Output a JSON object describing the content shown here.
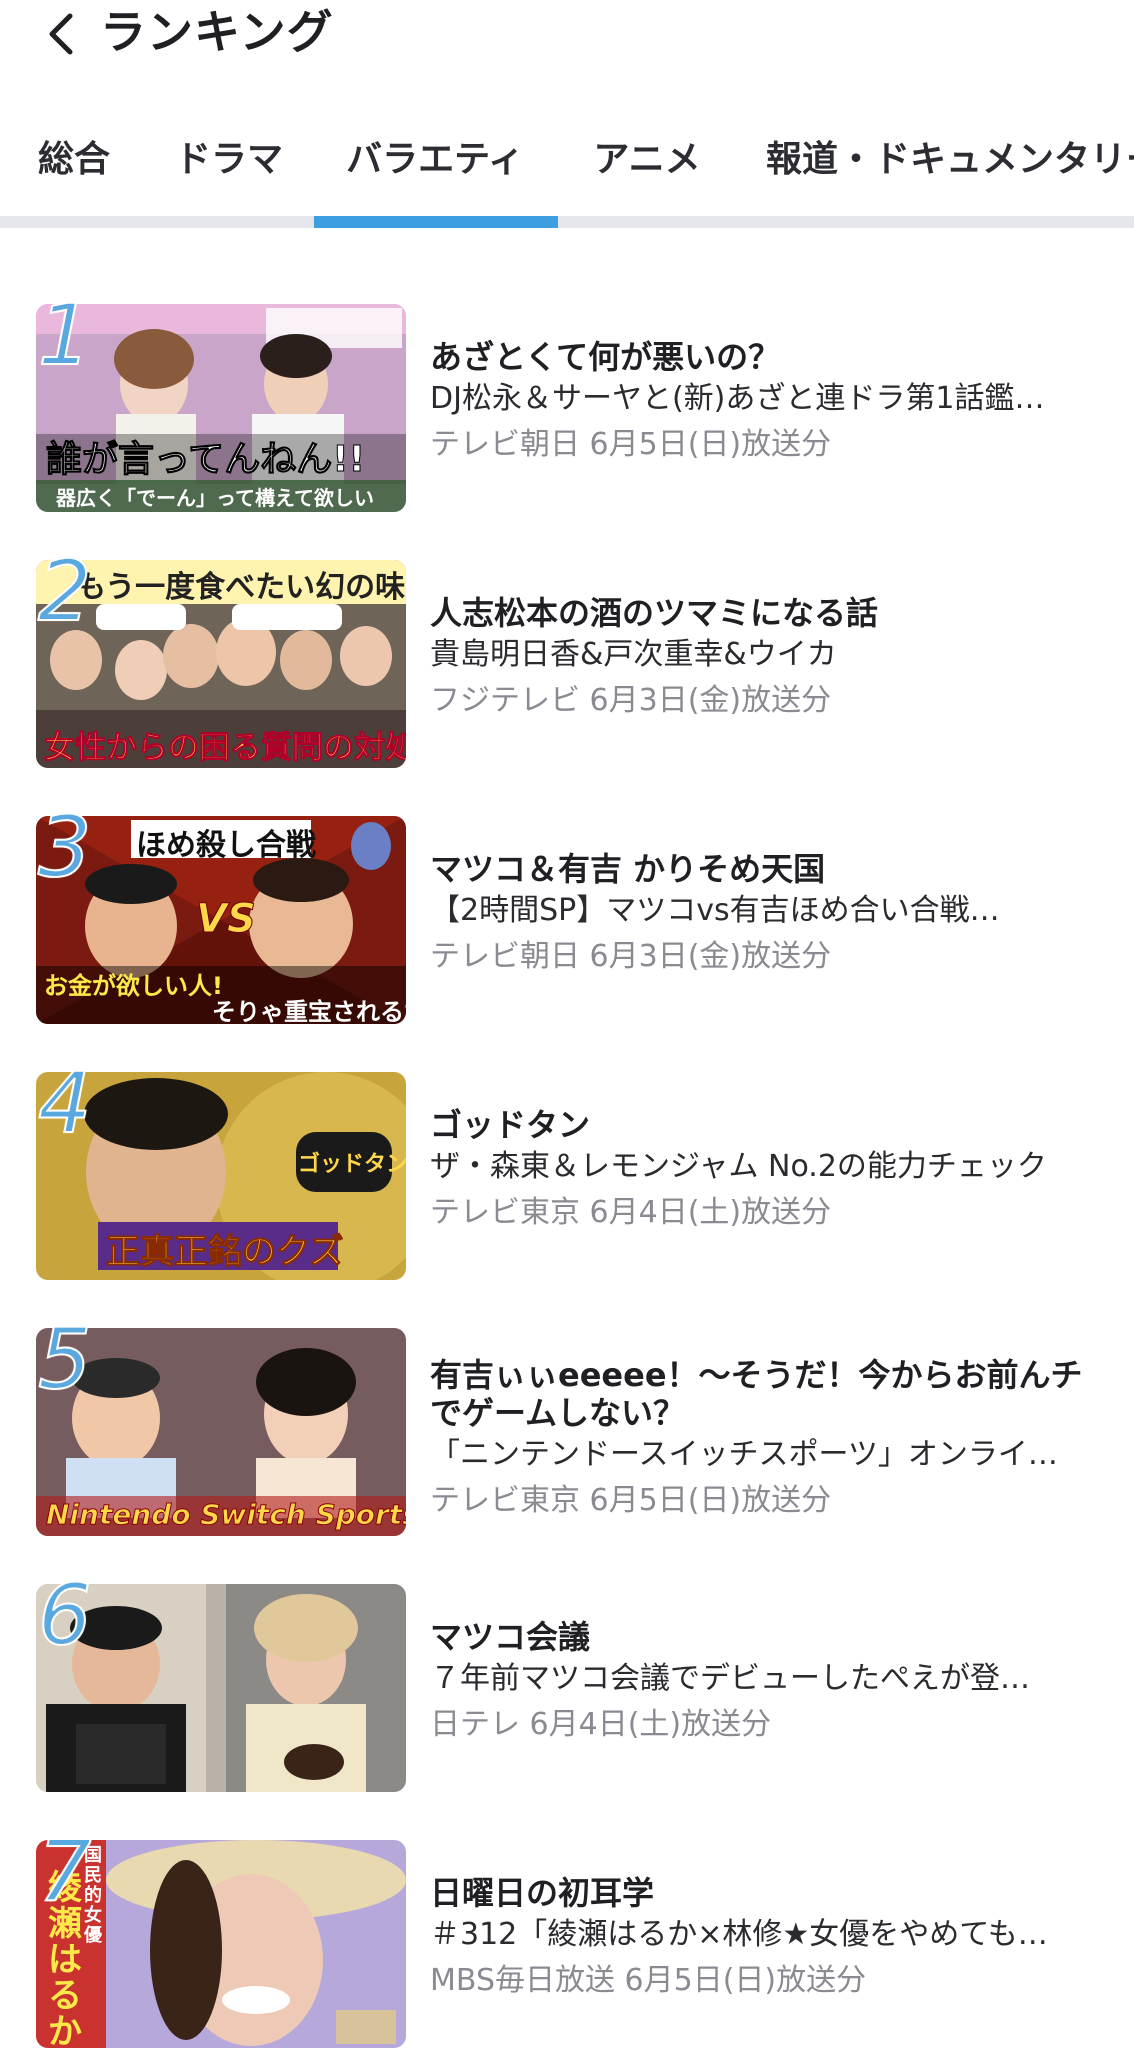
{
  "header": {
    "title": "ランキング"
  },
  "tabs": [
    {
      "label": "総合"
    },
    {
      "label": "ドラマ"
    },
    {
      "label": "バラエティ",
      "active": true
    },
    {
      "label": "アニメ"
    },
    {
      "label": "報道・ドキュメンタリー"
    }
  ],
  "accent_color": "#3d9ee0",
  "items": [
    {
      "rank": "1",
      "title": "あざとくて何が悪いの？",
      "subtitle": "DJ松永＆サーヤと(新)あざと連ドラ第1話鑑…",
      "date": "テレビ朝日 6月5日(日)放送分",
      "thumb_text": [
        "誰が言ってんねん!!",
        "器広く「でーん」って構えて欲しい"
      ]
    },
    {
      "rank": "2",
      "title": "人志松本の酒のツマミになる話",
      "subtitle": "貴島明日香&戸次重幸&ウイカ",
      "date": "フジテレビ 6月3日(金)放送分",
      "thumb_text": [
        "もう一度食べたい幻の味",
        "女性からの困る質問の対処法"
      ]
    },
    {
      "rank": "3",
      "title": "マツコ＆有吉 かりそめ天国",
      "subtitle": "【2時間SP】マツコvs有吉ほめ合い合戦…",
      "date": "テレビ朝日 6月3日(金)放送分",
      "thumb_text": [
        "ほめ殺し合戦",
        "VS",
        "お金が欲しい人!",
        "そりゃ重宝されるわ"
      ]
    },
    {
      "rank": "4",
      "title": "ゴッドタン",
      "subtitle": "ザ・森東＆レモンジャム No.2の能力チェック",
      "date": "テレビ東京 6月4日(土)放送分",
      "thumb_text": [
        "正真正銘のクズ",
        "ゴッドタン"
      ]
    },
    {
      "rank": "5",
      "title": "有吉ぃぃeeeee！～そうだ！今からお前んチでゲームしない？",
      "subtitle": "「ニンテンドースイッチスポーツ」オンライ…",
      "date": "テレビ東京 6月5日(日)放送分",
      "thumb_text": [
        "Nintendo Switch Sports"
      ]
    },
    {
      "rank": "6",
      "title": "マツコ会議",
      "subtitle": "７年前マツコ会議でデビューしたぺえが登…",
      "date": "日テレ 6月4日(土)放送分",
      "thumb_text": []
    },
    {
      "rank": "7",
      "title": "日曜日の初耳学",
      "subtitle": "＃312「綾瀬はるか×林修★女優をやめても…",
      "date": "MBS毎日放送 6月5日(日)放送分",
      "thumb_text": [
        "綾瀬はるか",
        "国民的女優"
      ]
    }
  ]
}
